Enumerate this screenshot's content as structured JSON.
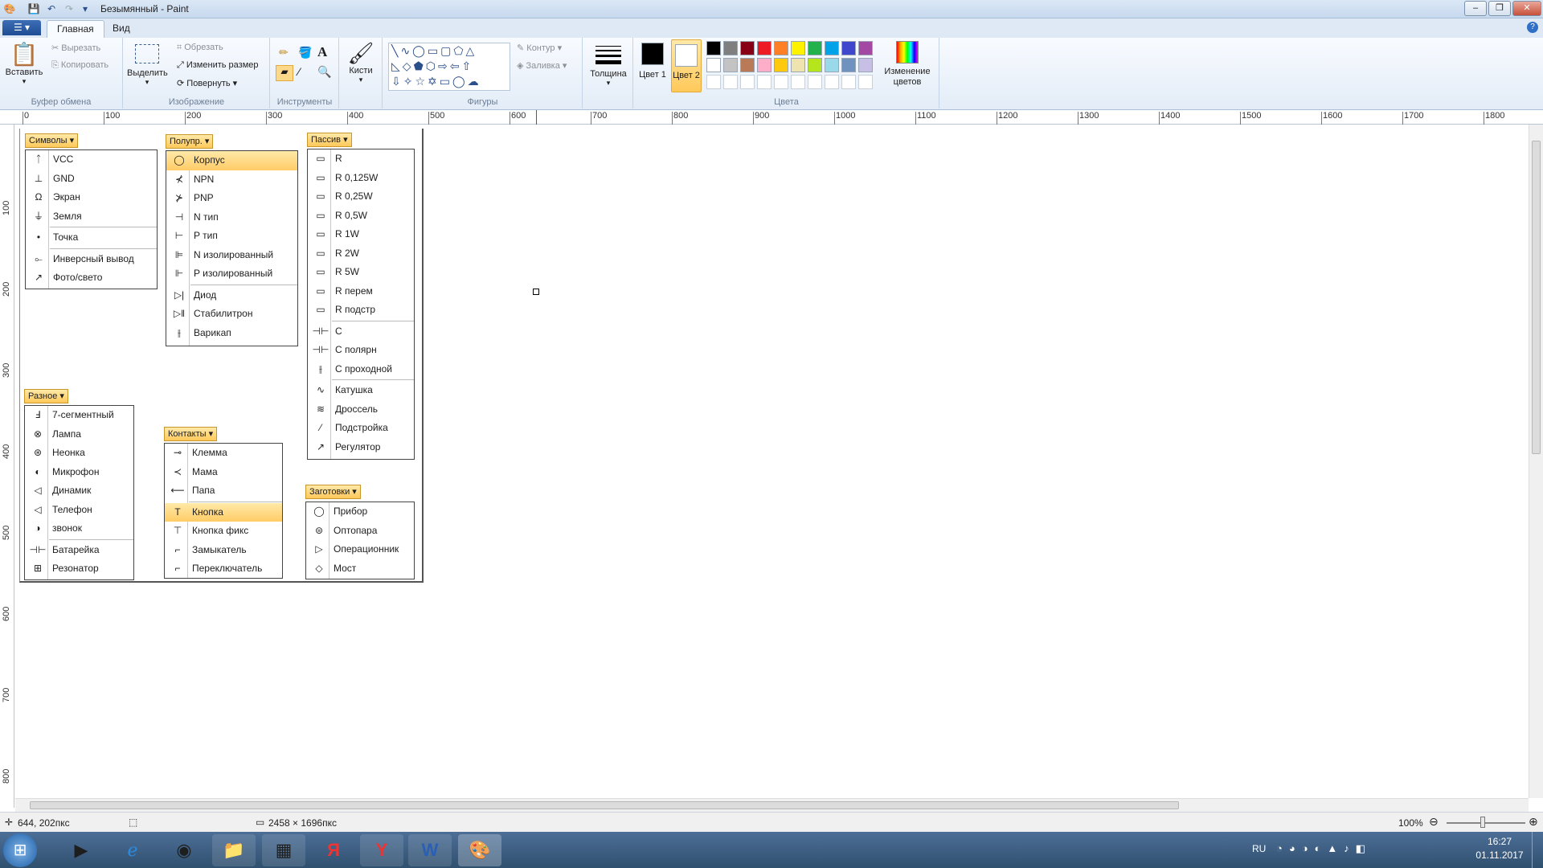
{
  "window": {
    "title": "Безымянный - Paint",
    "minimize": "–",
    "maximize": "❐",
    "close": "✕"
  },
  "tabs": {
    "menu": "☰ ▾",
    "home": "Главная",
    "view": "Вид"
  },
  "ribbon": {
    "clipboard": {
      "label": "Буфер обмена",
      "paste": "Вставить",
      "cut": "Вырезать",
      "copy": "Копировать"
    },
    "image": {
      "label": "Изображение",
      "select": "Выделить",
      "crop": "Обрезать",
      "resize": "Изменить размер",
      "rotate": "Повернуть"
    },
    "tools": {
      "label": "Инструменты"
    },
    "brushes": {
      "label": "Кисти"
    },
    "shapes": {
      "label": "Фигуры",
      "outline": "Контур",
      "fill": "Заливка"
    },
    "size": {
      "label": "Толщина"
    },
    "colors": {
      "label": "Цвета",
      "color1": "Цвет 1",
      "color2": "Цвет 2",
      "edit": "Изменение цветов",
      "color1_value": "#000000",
      "color2_value": "#ffffff",
      "row1": [
        "#000000",
        "#7f7f7f",
        "#880015",
        "#ed1c24",
        "#ff7f27",
        "#fff200",
        "#22b14c",
        "#00a2e8",
        "#3f48cc",
        "#a349a4"
      ],
      "row2": [
        "#ffffff",
        "#c3c3c3",
        "#b97a57",
        "#ffaec9",
        "#ffc90e",
        "#efe4b0",
        "#b5e61d",
        "#99d9ea",
        "#7092be",
        "#c8bfe7"
      ]
    }
  },
  "ruler": {
    "h_ticks": [
      "0",
      "100",
      "200",
      "300",
      "400",
      "500",
      "600",
      "700",
      "800",
      "900",
      "1000",
      "1100",
      "1200",
      "1300",
      "1400",
      "1500",
      "1600",
      "1700",
      "1800"
    ],
    "v_ticks": [
      "100",
      "200",
      "300",
      "400",
      "500",
      "600",
      "700",
      "800"
    ]
  },
  "canvas": {
    "symbols": {
      "header": "Символы",
      "items": [
        "VCC",
        "GND",
        "Экран",
        "Земля",
        "Точка",
        "Инверсный вывод",
        "Фото/свето"
      ]
    },
    "semis": {
      "header": "Полупр.",
      "items": [
        "Корпус",
        "NPN",
        "PNP",
        "N тип",
        "P тип",
        "N изолированный",
        "P изолированный",
        "Диод",
        "Стабилитрон",
        "Варикап"
      ]
    },
    "passive": {
      "header": "Пассив",
      "items": [
        "R",
        "R 0,125W",
        "R 0,25W",
        "R 0,5W",
        "R 1W",
        "R 2W",
        "R 5W",
        "R перем",
        "R подстр",
        "C",
        "C полярн",
        "C проходной",
        "Катушка",
        "Дроссель",
        "Подстройка",
        "Регулятор"
      ]
    },
    "misc": {
      "header": "Разное",
      "items": [
        "7-сегментный",
        "Лампа",
        "Неонка",
        "Микрофон",
        "Динамик",
        "Телефон",
        "звонок",
        "Батарейка",
        "Резонатор"
      ]
    },
    "contacts": {
      "header": "Контакты",
      "items": [
        "Клемма",
        "Мама",
        "Папа",
        "Кнопка",
        "Кнопка фикс",
        "Замыкатель",
        "Переключатель"
      ]
    },
    "blanks": {
      "header": "Заготовки",
      "items": [
        "Прибор",
        "Оптопара",
        "Операционник",
        "Мост"
      ]
    }
  },
  "status": {
    "coords": "644, 202пкс",
    "size": "2458 × 1696пкс",
    "zoom": "100%"
  },
  "tray": {
    "lang": "RU",
    "time": "16:27",
    "date": "01.11.2017"
  }
}
